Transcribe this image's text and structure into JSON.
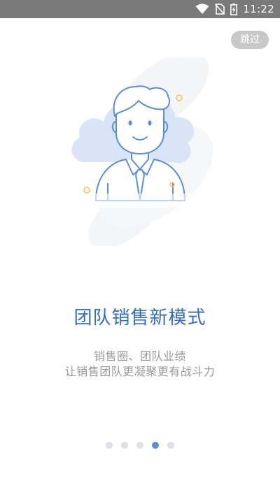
{
  "status_bar": {
    "time": "11:22",
    "background": "#7a7a7a",
    "icons": [
      "wifi-icon",
      "no-sim-icon",
      "battery-charging-icon"
    ]
  },
  "skip_label": "跳过",
  "illustration": {
    "icon": "salesman-avatar-icon"
  },
  "title": "团队销售新模式",
  "subtitle_lines": [
    "销售圈、团队业绩",
    "让销售团队更凝聚更有战斗力"
  ],
  "pager": {
    "count": 5,
    "active_index": 3
  },
  "colors": {
    "accent": "#2f6fc8",
    "active_dot": "#5b8fdb",
    "inactive_dot": "#dde1e8",
    "subtitle": "#9a9a9a",
    "skip_bg": "#c8c8c8"
  }
}
